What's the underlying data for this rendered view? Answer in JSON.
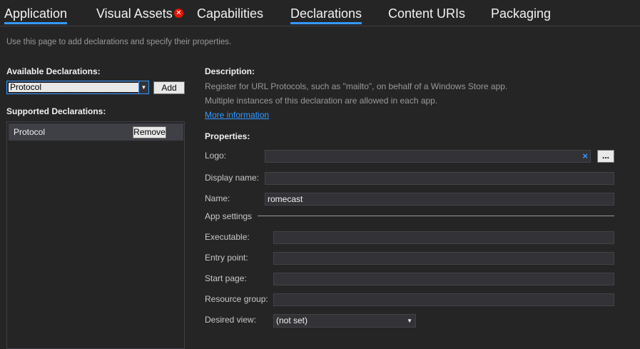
{
  "tabs": [
    {
      "label": "Application",
      "active": true
    },
    {
      "label": "Visual Assets",
      "active": false,
      "error": true
    },
    {
      "label": "Capabilities",
      "active": false
    },
    {
      "label": "Declarations",
      "active": true
    },
    {
      "label": "Content URIs",
      "active": false
    },
    {
      "label": "Packaging",
      "active": false
    }
  ],
  "hint": "Use this page to add declarations and specify their properties.",
  "left": {
    "available_label": "Available Declarations:",
    "available_selected": "Protocol",
    "add_label": "Add",
    "supported_label": "Supported Declarations:",
    "supported_items": [
      {
        "label": "Protocol",
        "remove_label": "Remove"
      }
    ]
  },
  "right": {
    "description_label": "Description:",
    "description_line1": "Register for URL Protocols, such as \"mailto\", on behalf of a Windows Store app.",
    "description_line2": "Multiple instances of this declaration are allowed in each app.",
    "more_info": "More information",
    "properties_label": "Properties:",
    "logo_label": "Logo:",
    "logo_value": "",
    "logo_clear_icon": "×",
    "browse_label": "...",
    "display_name_label": "Display name:",
    "display_name_value": "",
    "name_label": "Name:",
    "name_value": "romecast",
    "app_settings_label": "App settings",
    "executable_label": "Executable:",
    "executable_value": "",
    "entry_point_label": "Entry point:",
    "entry_point_value": "",
    "start_page_label": "Start page:",
    "start_page_value": "",
    "resource_group_label": "Resource group:",
    "resource_group_value": "",
    "desired_view_label": "Desired view:",
    "desired_view_value": "(not set)"
  },
  "icons": {
    "error": "error-icon",
    "dropdown": "chevron-down-icon",
    "clear": "clear-icon"
  },
  "colors": {
    "background": "#252526",
    "accent": "#3399ff",
    "error": "#e51400"
  }
}
